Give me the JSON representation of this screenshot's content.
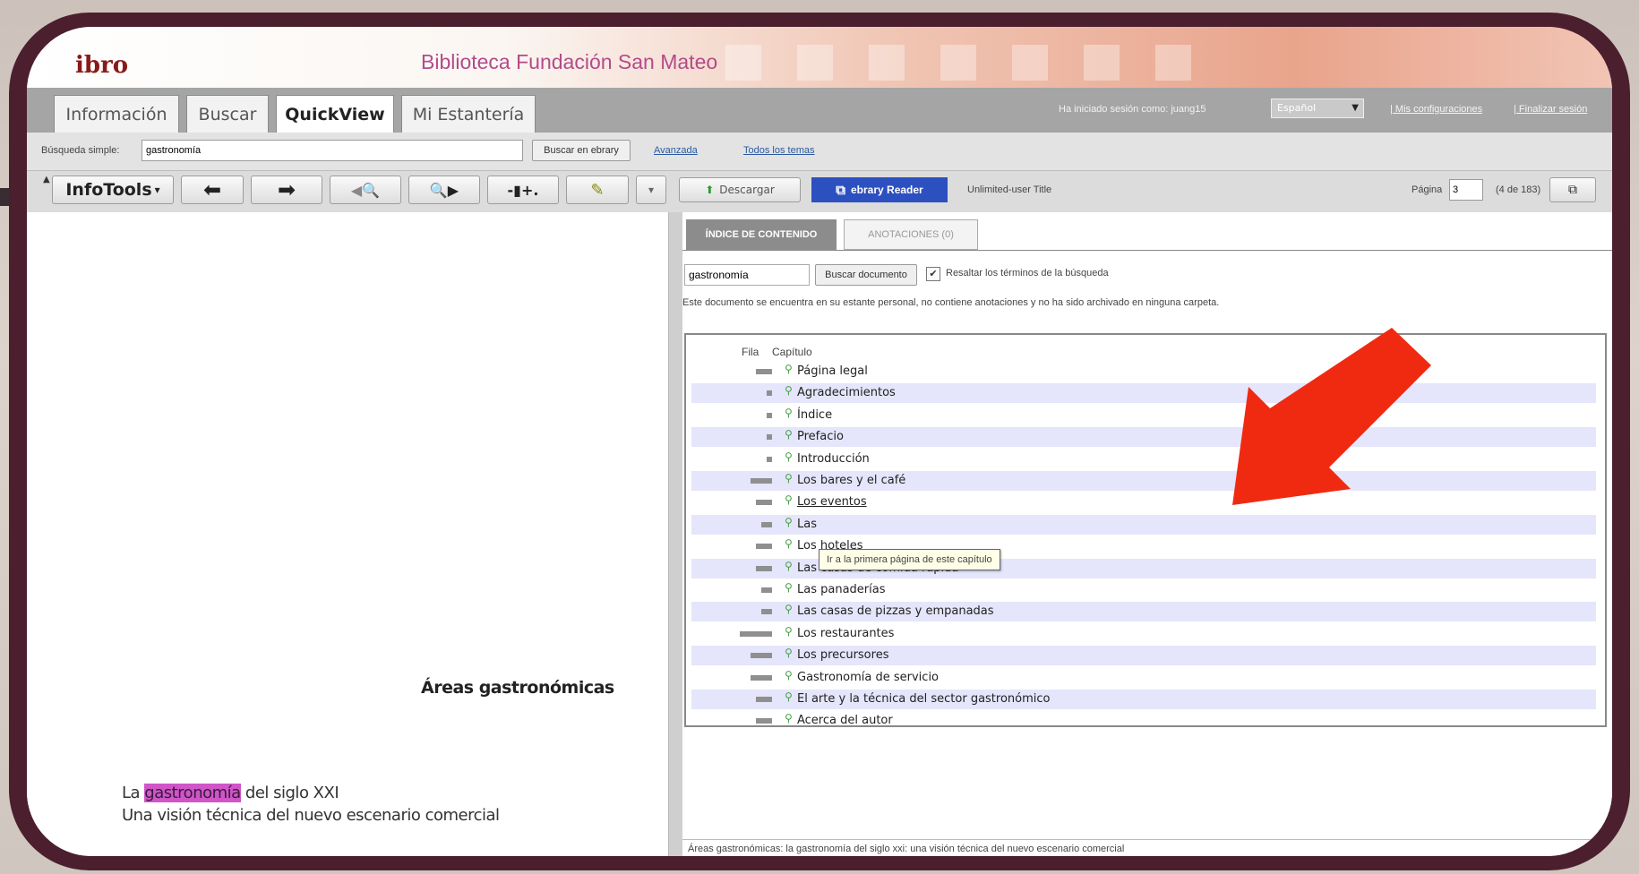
{
  "brand": "ibro",
  "library_name": "Biblioteca Fundación San Mateo",
  "tabs": [
    {
      "label": "Información",
      "active": false
    },
    {
      "label": "Buscar",
      "active": false
    },
    {
      "label": "QuickView",
      "active": true
    },
    {
      "label": "Mi Estantería",
      "active": false
    }
  ],
  "session": {
    "logged_in_text": "Ha iniciado sesión como: juang15",
    "language": "Español",
    "settings_link": "| Mis configuraciones",
    "logout_link": "| Finalizar sesión"
  },
  "search": {
    "label": "Búsqueda simple:",
    "value": "gastronomía",
    "button": "Buscar en ebrary",
    "advanced_link": "Avanzada",
    "topics_link": "Todos los temas"
  },
  "toolbar": {
    "infotools_label": "InfoTools",
    "download_label": "Descargar",
    "reader_label": "ebrary Reader",
    "license_text": "Unlimited-user Title",
    "page_label": "Página",
    "page_value": "3",
    "page_count": "(4 de 183)"
  },
  "book": {
    "heading": "Áreas gastronómicas",
    "line1_before": "La ",
    "line1_highlight": "gastronomía",
    "line1_after": " del siglo XXI",
    "line2": "Una visión técnica del nuevo escenario comercial"
  },
  "panel": {
    "tab_contents": "ÍNDICE DE CONTENIDO",
    "tab_annotations": "ANOTACIONES (0)",
    "search_value": "gastronomía",
    "search_button": "Buscar documento",
    "highlight_label": "Resaltar los términos de la búsqueda",
    "note": "Este documento se encuentra en su estante personal, no contiene anotaciones y no ha sido archivado en ninguna carpeta.",
    "col_hits": "Fila",
    "col_chapter": "Capítulo",
    "tooltip": "Ir a la primera página de este capítulo",
    "footer": "Áreas gastronómicas: la gastronomía del siglo xxi: una visión técnica del nuevo escenario comercial"
  },
  "toc": [
    {
      "title": "Página legal",
      "hits": 3
    },
    {
      "title": "Agradecimientos",
      "hits": 1
    },
    {
      "title": "Índice",
      "hits": 1
    },
    {
      "title": "Prefacio",
      "hits": 1
    },
    {
      "title": "Introducción",
      "hits": 1
    },
    {
      "title": "Los bares y el café",
      "hits": 4
    },
    {
      "title": "Los eventos",
      "hits": 3
    },
    {
      "title": "Las",
      "hits": 2
    },
    {
      "title": "Los hoteles",
      "hits": 3
    },
    {
      "title": "Las casas de comida rápida",
      "hits": 3
    },
    {
      "title": "Las panaderías",
      "hits": 2
    },
    {
      "title": "Las casas de pizzas y empanadas",
      "hits": 2
    },
    {
      "title": "Los restaurantes",
      "hits": 6
    },
    {
      "title": "Los precursores",
      "hits": 4
    },
    {
      "title": "Gastronomía de servicio",
      "hits": 4
    },
    {
      "title": "El arte y la técnica del sector gastronómico",
      "hits": 3
    },
    {
      "title": "Acerca del autor",
      "hits": 3
    }
  ],
  "colors": {
    "frame": "#4b1f2e",
    "arrow": "#f02a10",
    "highlight": "#cf55c8",
    "reader": "#2d50c0"
  }
}
